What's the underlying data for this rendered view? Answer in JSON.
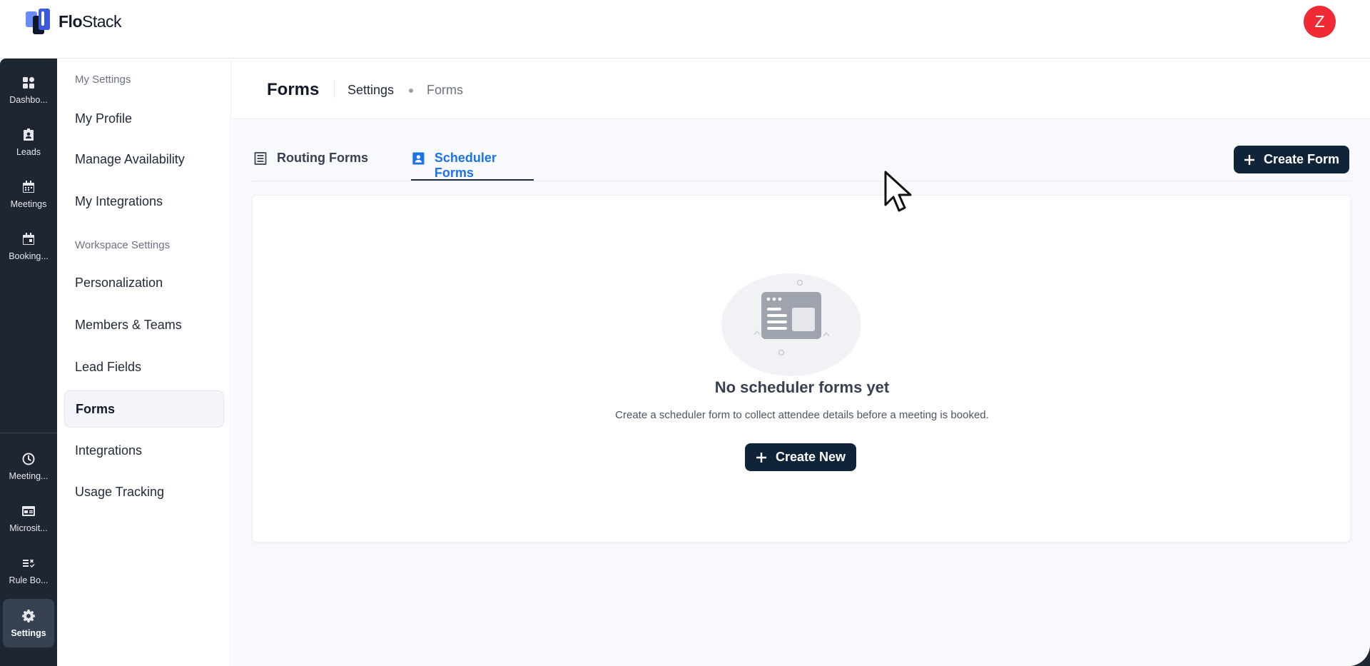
{
  "app": {
    "logo_text_bold": "Flo",
    "logo_text_rest": "Stack",
    "avatar_initial": "Z",
    "avatar_color": "#ef2a35",
    "brand_color": "#0f2438",
    "accent_color": "#1a73e8"
  },
  "rail": {
    "items": [
      {
        "label": "Dashbo...",
        "icon": "dashboard-icon"
      },
      {
        "label": "Leads",
        "icon": "contact-badge-icon"
      },
      {
        "label": "Meetings",
        "icon": "calendar-icon"
      },
      {
        "label": "Booking...",
        "icon": "calendar-event-icon"
      },
      {
        "label": "Meeting...",
        "icon": "clock-icon"
      },
      {
        "label": "Microsit...",
        "icon": "web-page-icon"
      },
      {
        "label": "Rule Bo...",
        "icon": "rule-list-icon"
      },
      {
        "label": "Settings",
        "icon": "gear-icon",
        "active": true
      }
    ]
  },
  "sidebar": {
    "my_settings_label": "My Settings",
    "workspace_settings_label": "Workspace Settings",
    "items": [
      {
        "label": "My Profile"
      },
      {
        "label": "Manage Availability"
      },
      {
        "label": "My Integrations"
      },
      {
        "label": "Personalization"
      },
      {
        "label": "Members & Teams"
      },
      {
        "label": "Lead Fields"
      },
      {
        "label": "Forms",
        "active": true
      },
      {
        "label": "Integrations"
      },
      {
        "label": "Usage Tracking"
      }
    ]
  },
  "header": {
    "title": "Forms",
    "breadcrumb": [
      "Settings",
      "Forms"
    ]
  },
  "tabs": [
    {
      "label": "Routing Forms",
      "icon": "list-form-icon",
      "active": false
    },
    {
      "label": "Scheduler Forms",
      "icon": "contact-form-icon",
      "active": true
    }
  ],
  "actions": {
    "create_form_label": "Create Form",
    "create_new_label": "Create New"
  },
  "empty_state": {
    "title": "No scheduler forms yet",
    "subtitle": "Create a scheduler form to collect attendee details before a meeting is booked.",
    "illustration": "browser-window-illustration"
  }
}
